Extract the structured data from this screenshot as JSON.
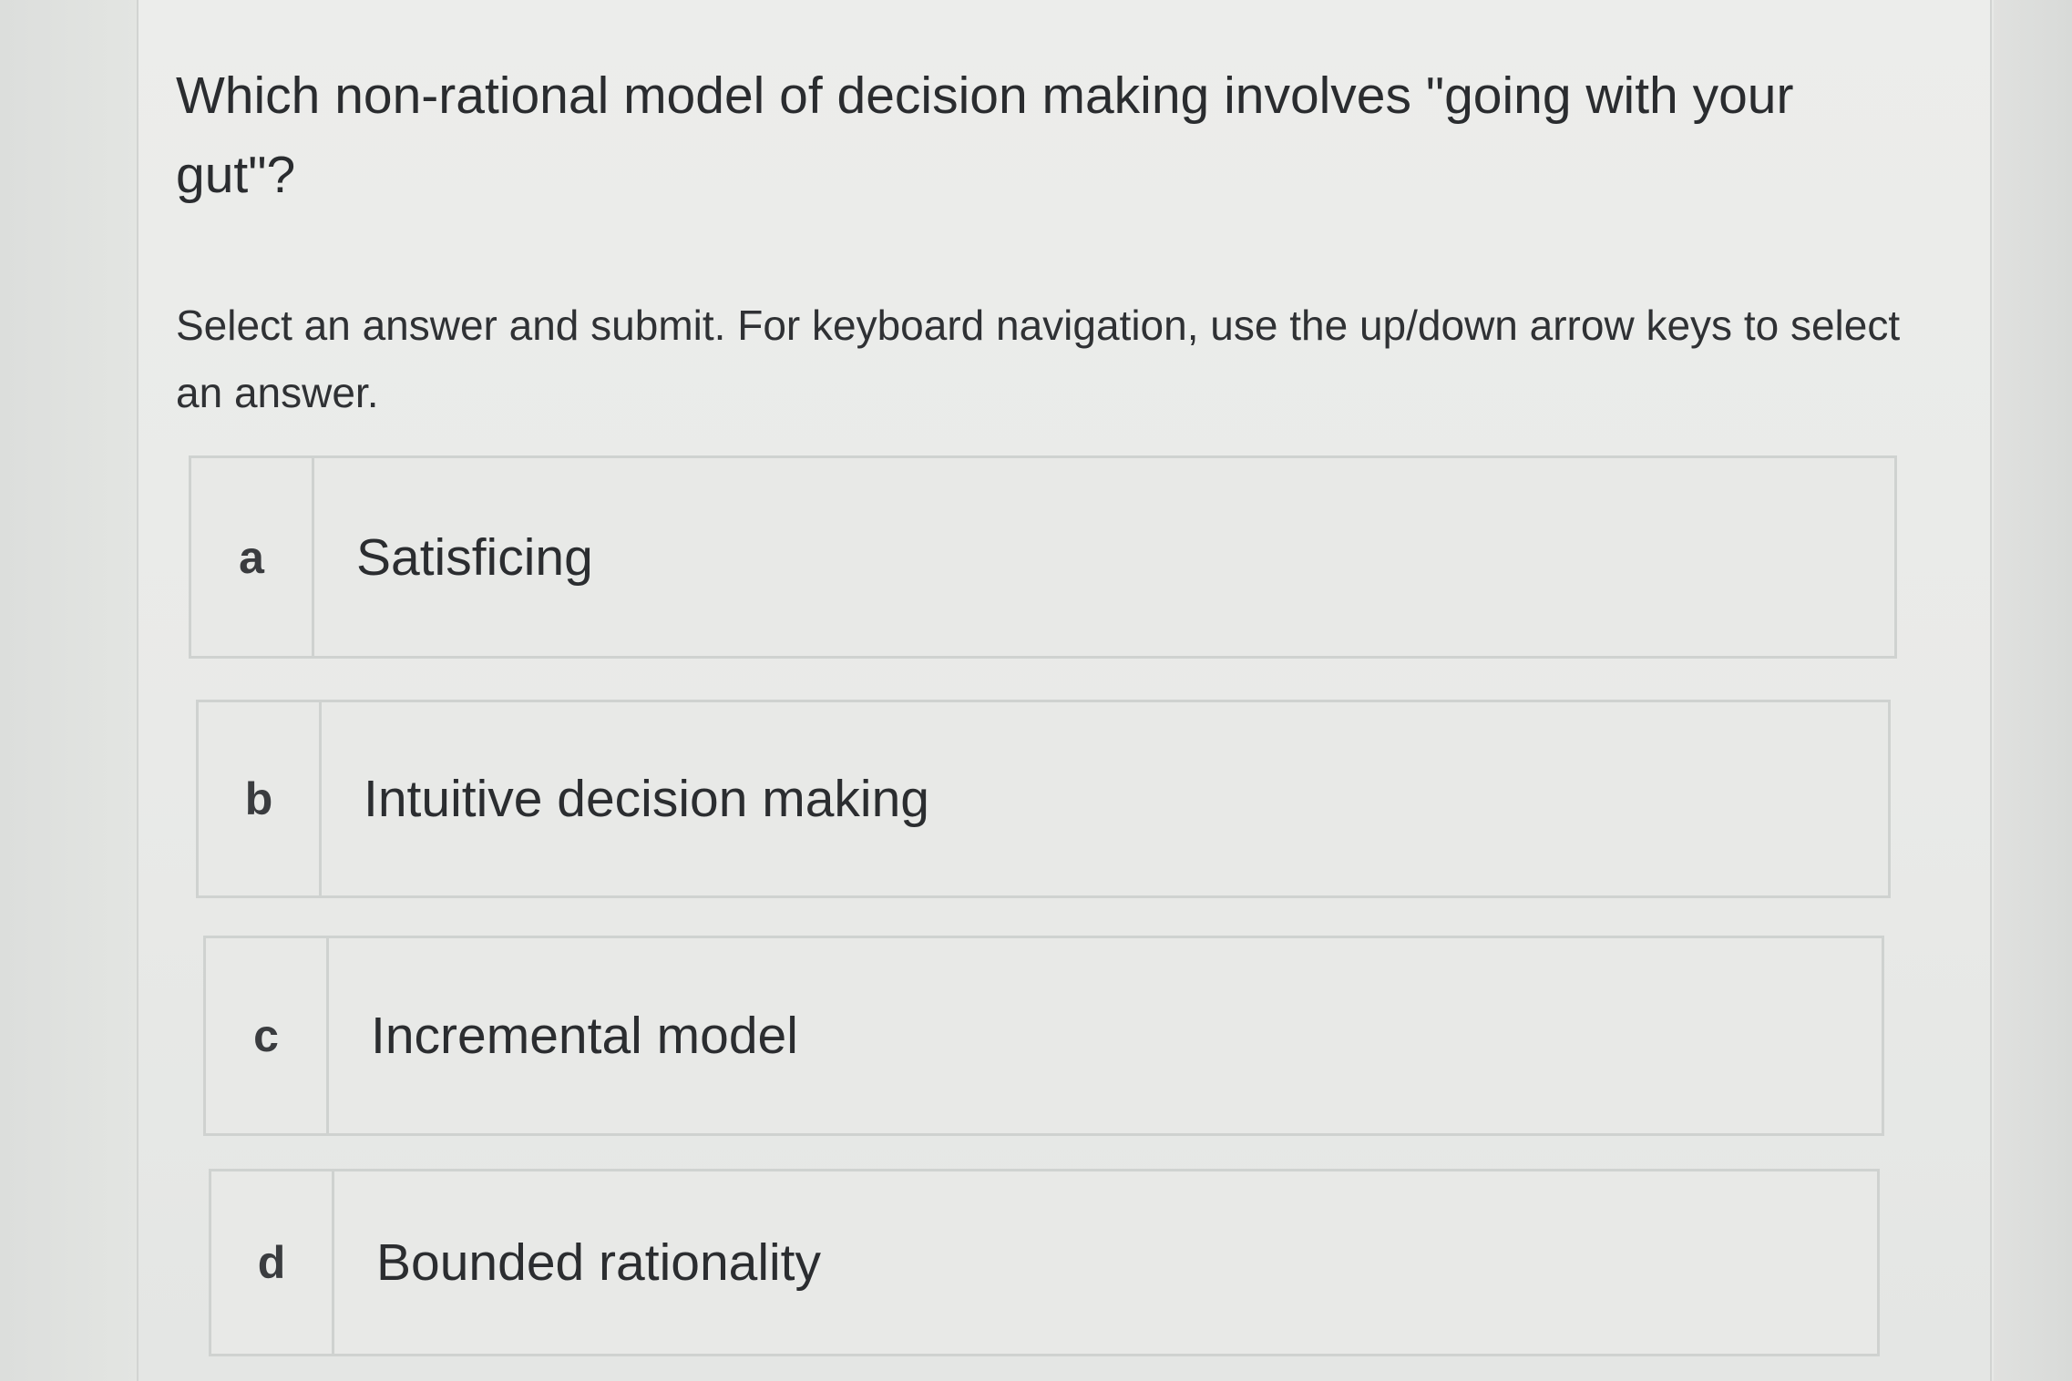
{
  "question": {
    "text": "Which non-rational model of decision making involves \"going with your gut\"?"
  },
  "instructions": {
    "text": "Select an answer and submit. For keyboard navigation, use the up/down arrow keys to select an answer."
  },
  "options": [
    {
      "letter": "a",
      "label": "Satisficing"
    },
    {
      "letter": "b",
      "label": "Intuitive decision making"
    },
    {
      "letter": "c",
      "label": "Incremental model"
    },
    {
      "letter": "d",
      "label": "Bounded rationality"
    }
  ]
}
